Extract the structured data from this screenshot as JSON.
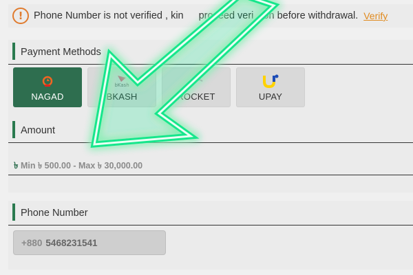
{
  "alert": {
    "text": "Phone Number is not verified , kin",
    "text_tail": "proceed veri",
    "text_end": "on before withdrawal.",
    "link": "Verify",
    "icon": "exclamation-circle-icon",
    "icon_glyph": "!"
  },
  "payment": {
    "title": "Payment Methods",
    "methods": [
      {
        "label": "NAGAD",
        "logo": "nagad-logo",
        "active": true
      },
      {
        "label": "BKASH",
        "logo": "bkash-logo",
        "logo_text": "bKash",
        "active": false
      },
      {
        "label": "ROCKET",
        "logo": "rocket-logo",
        "active": false
      },
      {
        "label": "UPAY",
        "logo": "upay-logo",
        "active": false
      }
    ]
  },
  "amount": {
    "title": "Amount",
    "currency_symbol": "৳",
    "range_text": "Min ৳ 500.00 - Max ৳ 30,000.00"
  },
  "phone": {
    "title": "Phone Number",
    "prefix": "+880",
    "value": "5468231541"
  },
  "colors": {
    "accent_green": "#2e6e4f",
    "alert_orange": "#e07b2e",
    "arrow_green": "#19e68c"
  }
}
